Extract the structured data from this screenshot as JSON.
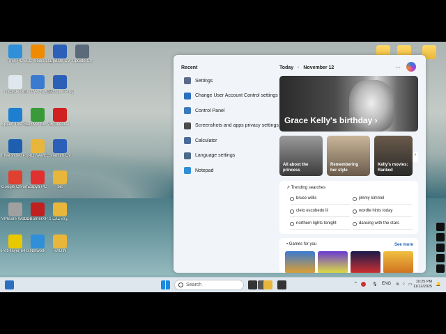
{
  "desktop": {
    "icons": [
      {
        "label": "This PC",
        "color": "#2f8fd8"
      },
      {
        "label": "VLC media player",
        "color": "#f08a00"
      },
      {
        "label": "Update CV",
        "color": "#2b5fb8"
      },
      {
        "label": "Update CV",
        "color": "#5a6a7a"
      },
      {
        "label": "Recycle Bin",
        "color": "#dfe8ee"
      },
      {
        "label": "Recover My Hard Drive",
        "color": "#3a7ad0"
      },
      {
        "label": "Glasspire Progre...",
        "color": "#2b5fb8"
      },
      {
        "label": "Speed Test Pro",
        "color": "#1e7fd0"
      },
      {
        "label": "Recover My Videos",
        "color": "#3a9a3a"
      },
      {
        "label": "Screenlife",
        "color": "#d02020"
      },
      {
        "label": "Free Video Player",
        "color": "#1e5fb0"
      },
      {
        "label": "[NO NAME]",
        "color": "#e8b63a"
      },
      {
        "label": "Shamim CV",
        "color": "#2b5fb8"
      },
      {
        "label": "Google Chrome",
        "color": "#e04030"
      },
      {
        "label": "Zapya PC",
        "color": "#e03030"
      },
      {
        "label": "bill",
        "color": "#e8b63a"
      },
      {
        "label": "VMware Workstation",
        "color": "#a0a0a0"
      },
      {
        "label": "CDBurnerXP 16",
        "color": "#c02020"
      },
      {
        "label": "ولاء بنات",
        "color": "#e8b63a"
      },
      {
        "label": "PotPlayer 64 bit",
        "color": "#e8c800"
      },
      {
        "label": "Network",
        "color": "#2f8fd8"
      },
      {
        "label": "RADIN",
        "color": "#e8b63a"
      }
    ]
  },
  "panel": {
    "recent_header": "Recent",
    "recent_items": [
      {
        "label": "Settings",
        "icon": "gear-icon",
        "color": "#5a6a8a"
      },
      {
        "label": "Change User Account Control settings",
        "icon": "flag-icon",
        "color": "#2b6fc0"
      },
      {
        "label": "Control Panel",
        "icon": "control-panel-icon",
        "color": "#3a7ab8"
      },
      {
        "label": "Screenshots and apps privacy settings",
        "icon": "privacy-icon",
        "color": "#4a4a4a"
      },
      {
        "label": "Calculator",
        "icon": "calculator-icon",
        "color": "#4a6a9a"
      },
      {
        "label": "Language settings",
        "icon": "language-icon",
        "color": "#4a6a8a"
      },
      {
        "label": "Notepad",
        "icon": "notepad-icon",
        "color": "#2f8fd8"
      }
    ],
    "today_label": "Today",
    "date_label": "November 12",
    "hero_title": "Grace Kelly's birthday ›",
    "cards": [
      {
        "line1": "All about the",
        "line2": "princess"
      },
      {
        "line1": "Remembering",
        "line2": "her style"
      },
      {
        "line1": "Kelly's movies:",
        "line2": "Ranked"
      }
    ],
    "trending_header": "Trending searches",
    "trending": [
      "bruce willis",
      "jimmy kimmel",
      "cleto escobedo iii",
      "wordle hints today",
      "northern lights tonight",
      "dancing with the stars"
    ],
    "games_header": "Games for you",
    "see_more": "See more"
  },
  "taskbar": {
    "search_placeholder": "Search",
    "lang": "ENG",
    "time": "10:25 PM",
    "date": "11/12/2025"
  }
}
